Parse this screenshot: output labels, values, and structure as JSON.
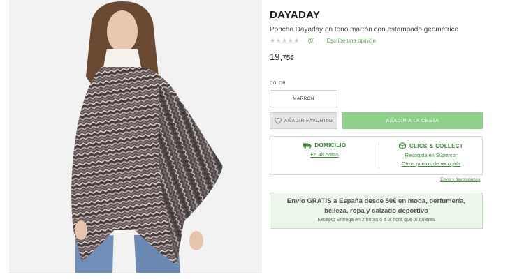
{
  "product": {
    "image_alt": "",
    "brand": "DAYADAY",
    "title": "Poncho Dayaday en tono marrón con estampado geométrico",
    "rating_stars": "★★★★★",
    "rating_value": 0,
    "review_count": "(0)",
    "write_review": "Escribe una opinión",
    "price_int": "19,",
    "price_dec": "75€"
  },
  "color": {
    "label": "COLOR",
    "selected": "MARRÓN"
  },
  "actions": {
    "favorite_label": "AÑADIR FAVORITO",
    "cart_label": "AÑADIR A LA CESTA"
  },
  "delivery": {
    "home": {
      "title": "DOMICILIO",
      "link": "En 48 horas"
    },
    "collect": {
      "title": "CLICK & COLLECT",
      "link1": "Recogida en Supercor",
      "link2": "Otros puntos de recogida"
    },
    "returns": "Envío y devoluciones"
  },
  "shipping": {
    "line1": "Envío GRATIS a España desde 50€ en moda, perfumería,",
    "line2": "belleza, ropa y calzado deportivo",
    "note": "Excepto Entrega en 2 horas o a la hora que tú quieras"
  },
  "colors": {
    "accent_green": "#3d8f36",
    "cart_green": "#8fd08a",
    "shipping_bg": "#eef7ec"
  }
}
